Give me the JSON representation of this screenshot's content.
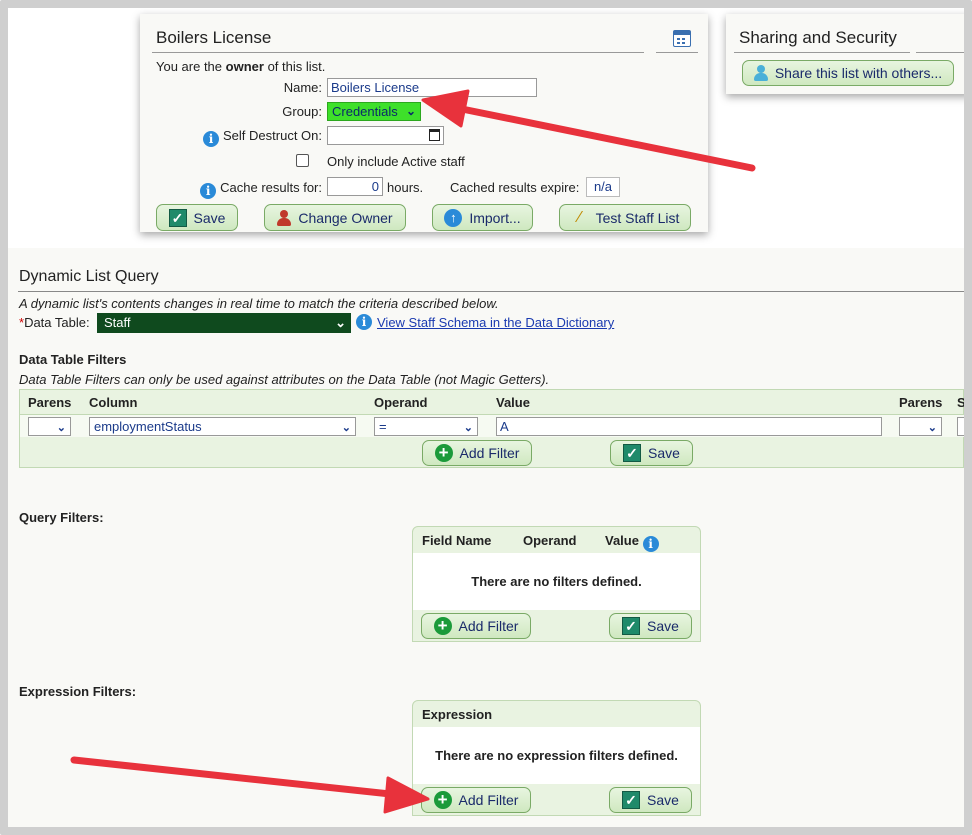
{
  "license_panel": {
    "title": "Boilers License",
    "owner_prefix": "You are the",
    "owner_bold": "owner",
    "owner_suffix": "of this list.",
    "name_label": "Name:",
    "name_value": "Boilers License",
    "group_label": "Group:",
    "group_value": "Credentials",
    "self_destruct_label": "Self Destruct On:",
    "active_staff_label": "Only include Active staff",
    "active_staff_checked": false,
    "cache_label": "Cache results for:",
    "cache_value": "0",
    "cache_unit": "hours.",
    "cache_expire_label": "Cached results expire:",
    "cache_expire_value": "n/a",
    "buttons": {
      "save": "Save",
      "change_owner": "Change Owner",
      "import": "Import...",
      "test": "Test Staff List"
    }
  },
  "sharing_panel": {
    "title": "Sharing and Security",
    "share_button": "Share this list with others..."
  },
  "query": {
    "title": "Dynamic List Query",
    "description": "A dynamic list's contents changes in real time to match the criteria described below.",
    "required_mark": "*",
    "data_table_label": "Data Table:",
    "data_table_value": "Staff",
    "schema_link": "View Staff Schema in the Data Dictionary"
  },
  "data_table_filters": {
    "heading": "Data Table Filters",
    "note": "Data Table Filters can only be used against attributes on the Data Table (not Magic Getters).",
    "columns": [
      "Parens",
      "Column",
      "Operand",
      "Value",
      "Parens",
      "S"
    ],
    "row": {
      "parens_open": "",
      "column": "employmentStatus",
      "operand": "=",
      "value": "A",
      "parens_close": ""
    },
    "add_filter": "Add Filter",
    "save": "Save"
  },
  "query_filters": {
    "heading": "Query Filters:",
    "columns": [
      "Field Name",
      "Operand",
      "Value"
    ],
    "empty_message": "There are no filters defined.",
    "add_filter": "Add Filter",
    "save": "Save"
  },
  "expression_filters": {
    "heading": "Expression Filters:",
    "column": "Expression",
    "empty_message": "There are no expression filters defined.",
    "add_filter": "Add Filter",
    "save": "Save"
  },
  "colors": {
    "group_highlight": "#3ee02a",
    "data_table_select": "#0f4a1e",
    "annotation_arrow": "#e8323c",
    "button_border": "#7aaa66",
    "grid_bg": "#e9f3e1"
  }
}
